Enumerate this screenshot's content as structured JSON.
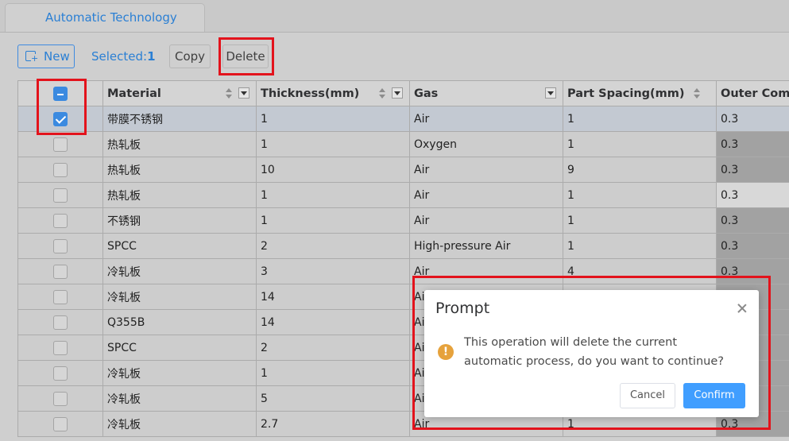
{
  "tab": {
    "title": "Automatic Technology"
  },
  "toolbar": {
    "new_label": "New",
    "selected_label": "Selected:",
    "selected_count": "1",
    "copy_label": "Copy",
    "delete_label": "Delete"
  },
  "table": {
    "columns": [
      "Material",
      "Thickness(mm)",
      "Gas",
      "Part Spacing(mm)",
      "Outer Comp"
    ],
    "rows": [
      {
        "checked": true,
        "material": "带膜不锈钢",
        "thickness": "1",
        "gas": "Air",
        "spacing": "1",
        "outer": "0.3"
      },
      {
        "checked": false,
        "material": "热轧板",
        "thickness": "1",
        "gas": "Oxygen",
        "spacing": "1",
        "outer": "0.3"
      },
      {
        "checked": false,
        "material": "热轧板",
        "thickness": "10",
        "gas": "Air",
        "spacing": "9",
        "outer": "0.3"
      },
      {
        "checked": false,
        "material": "热轧板",
        "thickness": "1",
        "gas": "Air",
        "spacing": "1",
        "outer": "0.3"
      },
      {
        "checked": false,
        "material": "不锈钢",
        "thickness": "1",
        "gas": "Air",
        "spacing": "1",
        "outer": "0.3"
      },
      {
        "checked": false,
        "material": "SPCC",
        "thickness": "2",
        "gas": "High-pressure Air",
        "spacing": "1",
        "outer": "0.3"
      },
      {
        "checked": false,
        "material": "冷轧板",
        "thickness": "3",
        "gas": "Air",
        "spacing": "4",
        "outer": "0.3"
      },
      {
        "checked": false,
        "material": "冷轧板",
        "thickness": "14",
        "gas": "Ai",
        "spacing": "",
        "outer": ""
      },
      {
        "checked": false,
        "material": "Q355B",
        "thickness": "14",
        "gas": "Ai",
        "spacing": "",
        "outer": ""
      },
      {
        "checked": false,
        "material": "SPCC",
        "thickness": "2",
        "gas": "Ai",
        "spacing": "",
        "outer": ""
      },
      {
        "checked": false,
        "material": "冷轧板",
        "thickness": "1",
        "gas": "Ai",
        "spacing": "",
        "outer": ""
      },
      {
        "checked": false,
        "material": "冷轧板",
        "thickness": "5",
        "gas": "Ai",
        "spacing": "",
        "outer": ""
      },
      {
        "checked": false,
        "material": "冷轧板",
        "thickness": "2.7",
        "gas": "Air",
        "spacing": "1",
        "outer": "0.3"
      }
    ]
  },
  "dialog": {
    "title": "Prompt",
    "message": "This operation will delete the current automatic process, do you want to continue?",
    "cancel_label": "Cancel",
    "confirm_label": "Confirm",
    "icon": "warning-icon"
  },
  "colors": {
    "accent": "#409eff",
    "highlight": "#e3131c",
    "warning": "#e6a23c"
  }
}
